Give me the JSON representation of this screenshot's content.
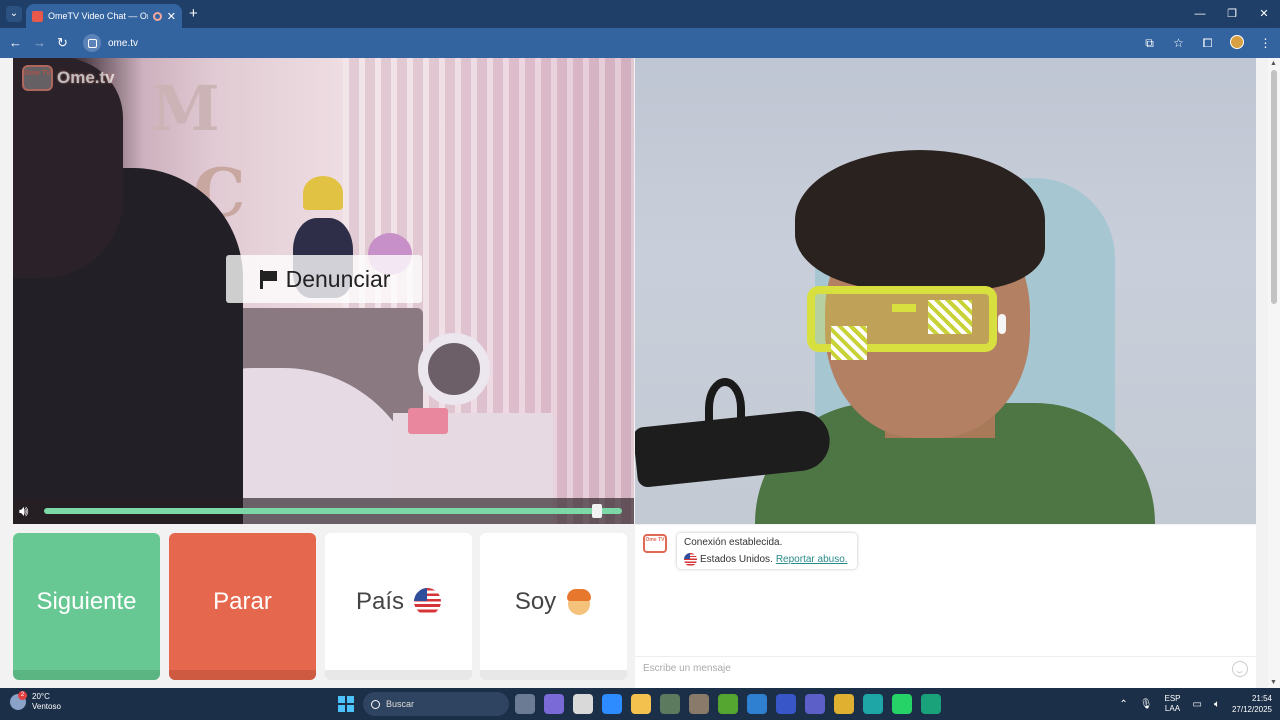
{
  "browser": {
    "tab_title": "OmeTV Video Chat — Ome",
    "tab_close": "✕",
    "new_tab": "+",
    "url": "ome.tv",
    "window_controls": [
      "—",
      "❐",
      "✕"
    ]
  },
  "video": {
    "logo_badge": "Ome TV",
    "logo_text": "Ome.tv",
    "report_button": "Denunciar",
    "volume_level": 0.93
  },
  "controls": {
    "next": "Siguiente",
    "stop": "Parar",
    "country": "País",
    "gender": "Soy"
  },
  "chat": {
    "logo_badge": "Ome TV",
    "status": "Conexión establecida.",
    "country_text": "Estados Unidos.",
    "report_link": "Reportar abuso.",
    "input_placeholder": "Escribe un mensaje"
  },
  "taskbar": {
    "weather_badge": "2",
    "temperature": "20°C",
    "weather_desc": "Ventoso",
    "search": "Buscar",
    "lang_top": "ESP",
    "lang_bottom": "LAA",
    "time": "21:54",
    "date": "27/12/2025"
  },
  "colors": {
    "next": "#68c893",
    "stop": "#e5674d",
    "volume": "#7dd8a8",
    "link": "#2b8a8a"
  }
}
